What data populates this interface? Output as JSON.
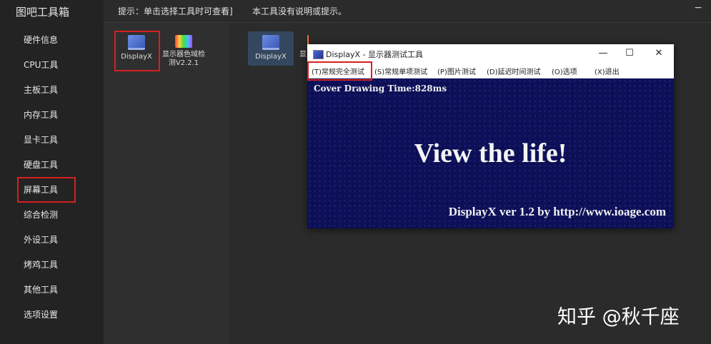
{
  "app": {
    "title": "图吧工具箱"
  },
  "sidebar": {
    "items": [
      {
        "label": "硬件信息"
      },
      {
        "label": "CPU工具"
      },
      {
        "label": "主板工具"
      },
      {
        "label": "内存工具"
      },
      {
        "label": "显卡工具"
      },
      {
        "label": "硬盘工具"
      },
      {
        "label": "屏幕工具"
      },
      {
        "label": "综合检测"
      },
      {
        "label": "外设工具"
      },
      {
        "label": "烤鸡工具"
      },
      {
        "label": "其他工具"
      },
      {
        "label": "选项设置"
      }
    ],
    "highlighted": "屏幕工具"
  },
  "hints": {
    "left": "提示：单击选择工具时可查看]",
    "right": "本工具没有说明或提示。",
    "close": "−"
  },
  "tools_left": [
    {
      "label": "DisplayX",
      "icon": "laptop-icon"
    },
    {
      "label_line1": "显示器色域检",
      "label_line2": "测V2.2.1",
      "icon": "rainbow-icon"
    }
  ],
  "tools_right": [
    {
      "label": "DisplayX",
      "icon": "laptop-icon"
    },
    {
      "label": "显",
      "icon": "rainbow-icon"
    }
  ],
  "displayx_window": {
    "title": "DisplayX - 显示器测试工具",
    "controls": {
      "minimize": "—",
      "maximize": "☐",
      "close": "✕"
    },
    "menu": [
      {
        "label": "(T)常规完全测试"
      },
      {
        "label": "(S)常规单项测试"
      },
      {
        "label": "(P)图片测试"
      },
      {
        "label": "(D)延迟时间测试"
      },
      {
        "label": "(O)选项"
      },
      {
        "label": "(X)退出"
      }
    ],
    "canvas": {
      "drawing_time": "Cover Drawing Time:828ms",
      "headline": "View the life!",
      "footer": "DisplayX ver 1.2 by http://www.ioage.com"
    }
  },
  "watermark": "知乎 @秋千座",
  "colors": {
    "highlight_red": "#d62020",
    "canvas_navy": "#0d1058",
    "sidebar_bg": "#232323"
  }
}
